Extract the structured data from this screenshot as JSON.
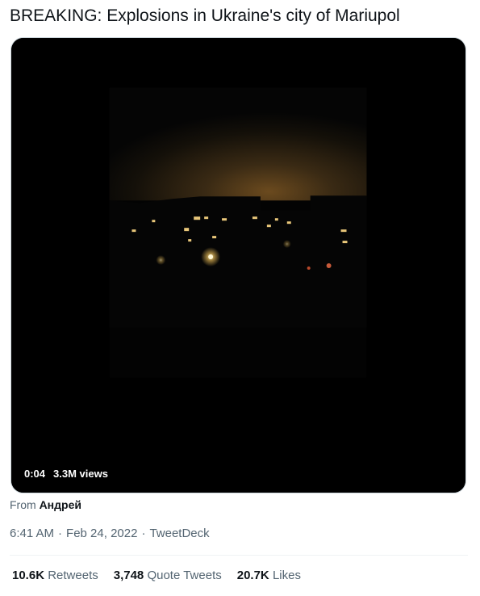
{
  "tweet": {
    "text": "BREAKING: Explosions in Ukraine's city of Mariupol"
  },
  "video": {
    "timestamp": "0:04",
    "views": "3.3M views"
  },
  "source": {
    "prefix": "From",
    "name": "Андрей"
  },
  "meta": {
    "time": "6:41 AM",
    "separator": "·",
    "date": "Feb 24, 2022",
    "client": "TweetDeck"
  },
  "stats": [
    {
      "value": "10.6K",
      "label": "Retweets"
    },
    {
      "value": "3,748",
      "label": "Quote Tweets"
    },
    {
      "value": "20.7K",
      "label": "Likes"
    }
  ]
}
